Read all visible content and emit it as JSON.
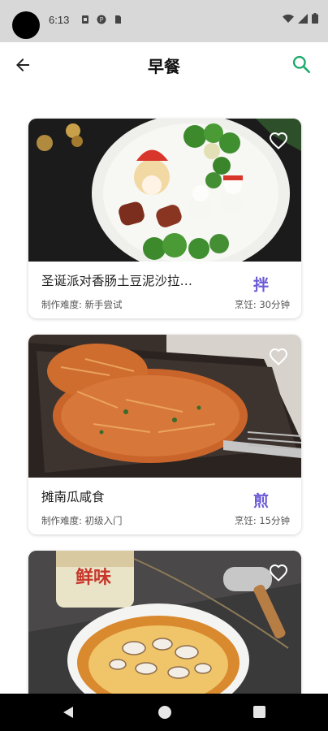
{
  "status_bar": {
    "time": "6:13",
    "icons_left": [
      "sim-icon",
      "p-icon",
      "sd-card-icon"
    ],
    "icons_right": [
      "wifi-icon",
      "signal-icon",
      "battery-icon"
    ]
  },
  "header": {
    "title": "早餐",
    "back_icon": "arrow-left-icon",
    "search_icon": "search-icon"
  },
  "colors": {
    "accent_green": "#1faa6c",
    "method_purple": "#6b5bd6"
  },
  "recipes": [
    {
      "title": "圣诞派对香肠土豆泥沙拉…",
      "method": "拌",
      "difficulty": "制作难度: 新手尝试",
      "time": "烹饪: 30分钟",
      "favorite_icon": "heart-outline-icon"
    },
    {
      "title": "摊南瓜咸食",
      "method": "煎",
      "difficulty": "制作难度: 初级入门",
      "time": "烹饪: 15分钟",
      "favorite_icon": "heart-outline-icon"
    },
    {
      "title": "",
      "method": "",
      "difficulty": "",
      "time": "",
      "favorite_icon": "heart-outline-icon",
      "package_text": "鲜味"
    }
  ],
  "nav_bar": {
    "back_icon": "nav-back-icon",
    "home_icon": "nav-home-icon",
    "recent_icon": "nav-recent-icon"
  }
}
